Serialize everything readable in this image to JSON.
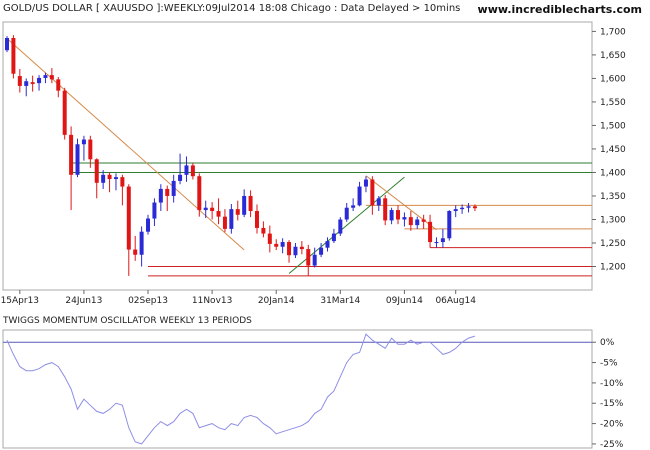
{
  "header": {
    "title": "GOLD/US DOLLAR [ XAUUSDO ]:WEEKLY:09Jul2014 18:08 Chicago : Data Delayed > 10mins",
    "brand": "www.incrediblecharts.com"
  },
  "oscillator": {
    "title": "TWIGGS MOMENTUM OSCILLATOR WEEKLY 13 PERIODS"
  },
  "colors": {
    "up": "#2a2ad6",
    "down": "#e01616",
    "trend": "#d4894a",
    "support": "#cc2222",
    "resistance": "#2d7d2d",
    "osc_line": "#8f8fe6",
    "zero_line": "#5858b8"
  },
  "chart_data": [
    {
      "type": "candlestick",
      "title": "GOLD/US DOLLAR [ XAUUSDO ]:WEEKLY",
      "y_ticks": [
        "1,700",
        "1,650",
        "1,600",
        "1,550",
        "1,500",
        "1,450",
        "1,400",
        "1,350",
        "1,300",
        "1,250",
        "1,200"
      ],
      "y_tick_values": [
        1700,
        1650,
        1600,
        1550,
        1500,
        1450,
        1400,
        1350,
        1300,
        1250,
        1200
      ],
      "ylim": [
        1150,
        1720
      ],
      "x_ticks": [
        "15Apr13",
        "24Jun13",
        "02Sep13",
        "11Nov13",
        "20Jan14",
        "31Mar14",
        "09Jun14",
        "06Aug14"
      ],
      "week_count": 74,
      "candles": [
        [
          1660,
          1690,
          1656,
          1686
        ],
        [
          1686,
          1692,
          1600,
          1610
        ],
        [
          1605,
          1620,
          1570,
          1584
        ],
        [
          1584,
          1600,
          1562,
          1594
        ],
        [
          1592,
          1606,
          1572,
          1588
        ],
        [
          1590,
          1607,
          1574,
          1601
        ],
        [
          1601,
          1612,
          1590,
          1607
        ],
        [
          1607,
          1622,
          1590,
          1598
        ],
        [
          1598,
          1603,
          1560,
          1574
        ],
        [
          1574,
          1580,
          1470,
          1480
        ],
        [
          1480,
          1498,
          1320,
          1395
        ],
        [
          1395,
          1472,
          1390,
          1460
        ],
        [
          1460,
          1478,
          1425,
          1470
        ],
        [
          1470,
          1478,
          1410,
          1428
        ],
        [
          1428,
          1430,
          1345,
          1378
        ],
        [
          1378,
          1405,
          1365,
          1395
        ],
        [
          1395,
          1400,
          1358,
          1386
        ],
        [
          1386,
          1398,
          1362,
          1390
        ],
        [
          1390,
          1395,
          1330,
          1370
        ],
        [
          1370,
          1375,
          1180,
          1236
        ],
        [
          1236,
          1265,
          1212,
          1225
        ],
        [
          1225,
          1285,
          1200,
          1274
        ],
        [
          1274,
          1310,
          1268,
          1302
        ],
        [
          1302,
          1345,
          1286,
          1336
        ],
        [
          1336,
          1375,
          1318,
          1365
        ],
        [
          1365,
          1372,
          1318,
          1350
        ],
        [
          1350,
          1395,
          1336,
          1382
        ],
        [
          1382,
          1440,
          1375,
          1395
        ],
        [
          1395,
          1434,
          1380,
          1415
        ],
        [
          1415,
          1420,
          1385,
          1392
        ],
        [
          1392,
          1398,
          1306,
          1320
        ],
        [
          1320,
          1340,
          1303,
          1325
        ],
        [
          1325,
          1337,
          1300,
          1318
        ],
        [
          1318,
          1345,
          1290,
          1306
        ],
        [
          1306,
          1322,
          1273,
          1280
        ],
        [
          1280,
          1333,
          1270,
          1322
        ],
        [
          1322,
          1340,
          1298,
          1310
        ],
        [
          1310,
          1364,
          1305,
          1350
        ],
        [
          1350,
          1362,
          1305,
          1318
        ],
        [
          1318,
          1332,
          1270,
          1282
        ],
        [
          1282,
          1296,
          1262,
          1270
        ],
        [
          1270,
          1287,
          1230,
          1248
        ],
        [
          1248,
          1258,
          1235,
          1242
        ],
        [
          1242,
          1260,
          1228,
          1252
        ],
        [
          1252,
          1256,
          1208,
          1224
        ],
        [
          1224,
          1250,
          1218,
          1242
        ],
        [
          1242,
          1254,
          1226,
          1237
        ],
        [
          1237,
          1246,
          1180,
          1202
        ],
        [
          1202,
          1240,
          1198,
          1225
        ],
        [
          1225,
          1250,
          1220,
          1240
        ],
        [
          1240,
          1262,
          1232,
          1254
        ],
        [
          1254,
          1280,
          1250,
          1270
        ],
        [
          1270,
          1305,
          1265,
          1300
        ],
        [
          1300,
          1335,
          1295,
          1325
        ],
        [
          1325,
          1345,
          1318,
          1330
        ],
        [
          1330,
          1380,
          1328,
          1370
        ],
        [
          1370,
          1392,
          1358,
          1385
        ],
        [
          1385,
          1392,
          1310,
          1330
        ],
        [
          1330,
          1350,
          1318,
          1345
        ],
        [
          1345,
          1352,
          1288,
          1298
        ],
        [
          1298,
          1325,
          1290,
          1320
        ],
        [
          1320,
          1330,
          1290,
          1300
        ],
        [
          1300,
          1315,
          1285,
          1305
        ],
        [
          1305,
          1318,
          1276,
          1288
        ],
        [
          1288,
          1306,
          1280,
          1300
        ],
        [
          1300,
          1310,
          1280,
          1295
        ],
        [
          1295,
          1310,
          1240,
          1252
        ],
        [
          1252,
          1262,
          1240,
          1252
        ],
        [
          1252,
          1280,
          1240,
          1260
        ],
        [
          1260,
          1320,
          1255,
          1318
        ],
        [
          1318,
          1330,
          1305,
          1322
        ],
        [
          1322,
          1332,
          1312,
          1325
        ],
        [
          1325,
          1335,
          1315,
          1328
        ],
        [
          1328,
          1332,
          1318,
          1324
        ]
      ],
      "resistance_levels": [
        1420,
        1400,
        1330,
        1280
      ],
      "support_levels": [
        1240,
        1200,
        1180
      ],
      "trend_lines": [
        {
          "from": [
            0,
            1685
          ],
          "to": [
            37,
            1235
          ]
        },
        {
          "from": [
            44,
            1185
          ],
          "to": [
            62,
            1390
          ]
        },
        {
          "from": [
            56,
            1393
          ],
          "to": [
            67,
            1278
          ]
        }
      ]
    },
    {
      "type": "line",
      "title": "TWIGGS MOMENTUM OSCILLATOR WEEKLY 13 PERIODS",
      "y_ticks": [
        "0%",
        "-5%",
        "-10%",
        "-15%",
        "-20%",
        "-25%"
      ],
      "y_tick_values": [
        0,
        -5,
        -10,
        -15,
        -20,
        -25
      ],
      "ylim": [
        -26,
        3
      ],
      "values": [
        0.5,
        -3,
        -6,
        -7,
        -7,
        -6.5,
        -5.5,
        -5,
        -6,
        -8.5,
        -11.5,
        -16.5,
        -14,
        -15.5,
        -17,
        -17.5,
        -16.5,
        -15,
        -15.5,
        -21,
        -24.5,
        -25,
        -23,
        -21,
        -19.5,
        -20.5,
        -19.5,
        -17.5,
        -16.5,
        -17.5,
        -21,
        -20.5,
        -20,
        -21,
        -21.5,
        -20,
        -20.5,
        -18.5,
        -18,
        -18.5,
        -20,
        -21,
        -22.5,
        -22,
        -21.5,
        -21,
        -20.5,
        -19.5,
        -17.5,
        -16.5,
        -13.5,
        -12,
        -8.5,
        -5,
        -3,
        -2.5,
        2,
        0.5,
        -0.5,
        -1.5,
        1,
        -0.5,
        -0.5,
        0.5,
        -0.5,
        0,
        0,
        -1.5,
        -3,
        -2.5,
        -1.5,
        0,
        1,
        1.5
      ]
    }
  ]
}
